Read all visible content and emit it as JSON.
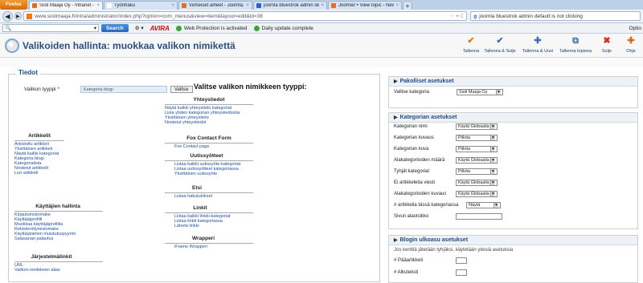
{
  "browser": {
    "firefox_label": "Firefox",
    "tabs": [
      {
        "title": "Sisti Maaja Oy - Intranet - Ylläpito",
        "color": "#e86a1c",
        "active": true
      },
      {
        "title": "Työnhaku",
        "color": "#ffffff",
        "active": false
      },
      {
        "title": "Viimeiset aiheet - Joomla.fi",
        "color": "#e86a1c",
        "active": false
      },
      {
        "title": "joomla bluestrok admin default for jo...",
        "color": "#2a5fcf",
        "active": false
      },
      {
        "title": "Joomla! • View topic - New template i...",
        "color": "#e86a1c",
        "active": false
      }
    ],
    "new_tab": "+",
    "url": "www.sistimaaja.fi/intra/administrator/index.php?option=com_menus&view=item&layout=edit&id=38",
    "search_engine": "g",
    "search_text": "joomla bluestrok admin default is not clicking"
  },
  "addon_toolbar": {
    "search_button": "Search",
    "avira": "AVIRA",
    "web_protection": "Web Protection is activated",
    "daily_update": "Daily update complete",
    "options": "Optio"
  },
  "admin": {
    "page_title": "Valikoiden hallinta: muokkaa valikon nimikettä",
    "buttons": [
      {
        "label": "Tallenna",
        "icon": "save-icon",
        "glyph": "✔",
        "color": "#e07b12"
      },
      {
        "label": "Tallenna & Sulje",
        "icon": "save-close-icon",
        "glyph": "✔",
        "color": "#3c6fb0"
      },
      {
        "label": "Tallenna & Uusi",
        "icon": "save-new-icon",
        "glyph": "✚",
        "color": "#3c6fb0"
      },
      {
        "label": "Tallenna topiona",
        "icon": "save-copy-icon",
        "glyph": "⧉",
        "color": "#3c6fb0"
      },
      {
        "label": "Sulje",
        "icon": "close-icon",
        "glyph": "✖",
        "color": "#d92b1e"
      },
      {
        "label": "Ohje",
        "icon": "help-icon",
        "glyph": "✚",
        "color": "#d96a18"
      }
    ]
  },
  "details": {
    "legend": "Tiedot",
    "menu_type_label": "Valikon tyyppi",
    "required_mark": "*",
    "menu_type_value": "Kategoria blogi",
    "select_button": "Valitse",
    "select_heading": "Valitse valikon nimikkeen tyyppi:",
    "groups": [
      {
        "title": "Yhteystiedot",
        "links": [
          "Näytä kaikki yhteystieto kategoriat",
          "Lista yhden kategorian yhteystiedoista",
          "Yksittäinen yhteystieto",
          "Nostetut yhteystiedot"
        ]
      },
      {
        "title": "Artikkelit",
        "links": [
          "Arkistoitu artikkeli",
          "Yksittäinen artikkeli",
          "Näytä kaikki kategoriat",
          "Kategoria blogi",
          "Kategorialista",
          "Nostetut artikkelit",
          "Luo artikkeli"
        ]
      },
      {
        "title": "Fox Contact Form",
        "links": [
          "Fox Contact page"
        ]
      },
      {
        "title": "Uutissyötteet",
        "links": [
          "Listaa kaikki uutissyöte-kategoriat",
          "Listaa uutissyötteet kategoriassa",
          "Yksittäinen uutissyöte"
        ]
      },
      {
        "title": "Etsi",
        "links": [
          "Listaa hakutulokset"
        ]
      },
      {
        "title": "Käyttäjien hallinta",
        "links": [
          "Kirjautumislomake",
          "Käyttäjäprofiili",
          "Muokkaa käyttäjäprofiilia",
          "Rekisteröitymislomake",
          "Käyttäjänimen muistutuspyyntö",
          "Salasanan palautus"
        ]
      },
      {
        "title": "Linkit",
        "links": [
          "Listaa kaikki linkki-kategoriat",
          "Listaa linkit kategoriassa",
          "Lähetä linkki"
        ]
      },
      {
        "title": "Järjestelmälinkit",
        "links": [
          "URL",
          "Valikon nimikkeen alias"
        ]
      },
      {
        "title": "Wrapperi",
        "links": [
          "iFrame Wrapperi"
        ]
      }
    ]
  },
  "required_options": {
    "title": "Pakolliset asetukset",
    "category_label": "Valitse kategoria",
    "category_value": "Sisti Maaja Oy"
  },
  "category_options": {
    "title": "Kategorian asetukset",
    "rows": [
      {
        "label": "Kategorian nimi",
        "value": "Käytä Globaalia",
        "type": "select"
      },
      {
        "label": "Kategorian kuvaus",
        "value": "Piilota",
        "type": "select"
      },
      {
        "label": "Kategorian kuva",
        "value": "Piilota",
        "type": "select"
      },
      {
        "label": "Alakategorioiden määrä",
        "value": "Käytä Globaalia",
        "type": "select"
      },
      {
        "label": "Tyhjät kategoriat",
        "value": "Piilota",
        "type": "select"
      },
      {
        "label": "Ei artikkeleita viesti",
        "value": "Käytä Globaalia",
        "type": "select"
      },
      {
        "label": "Alakategorioiden kuvaus",
        "value": "Käytä Globaalia",
        "type": "select"
      },
      {
        "label": "# artikkelia tässä kategoriassa",
        "value": "Näytä",
        "type": "select"
      },
      {
        "label": "Sivun alaotsikko",
        "value": "",
        "type": "text"
      }
    ]
  },
  "blog_options": {
    "title": "Blogin ulkoasu asetukset",
    "note": "Jos kenttiä jätetään tyhjäksi, käytetään yleisiä asetuksia",
    "rows": [
      {
        "label": "# Pääartikkeli",
        "value": ""
      },
      {
        "label": "# Alkuteksti",
        "value": ""
      }
    ]
  }
}
